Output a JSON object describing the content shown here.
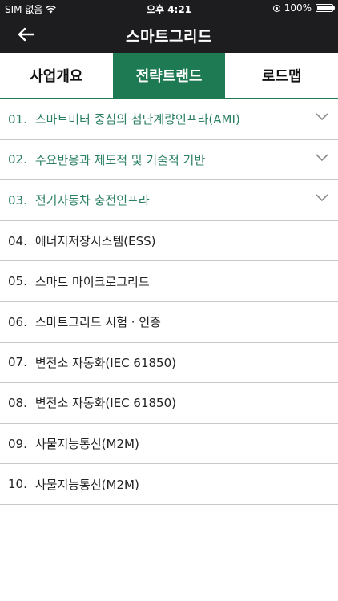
{
  "status_bar": {
    "carrier": "SIM 없음",
    "time": "오후 4:21",
    "battery": "100%",
    "battery_level": 1.0
  },
  "nav": {
    "title": "스마트그리드",
    "back_icon": "arrow-left-icon"
  },
  "tabs": [
    {
      "label": "사업개요",
      "active": false
    },
    {
      "label": "전략트랜드",
      "active": true
    },
    {
      "label": "로드맵",
      "active": false
    }
  ],
  "colors": {
    "brand": "#1e7a52",
    "expandable_text": "#2b8063",
    "bar": "#1d1d1f"
  },
  "list": [
    {
      "num": "01.",
      "label": "스마트미터 중심의 첨단계량인프라(AMI)",
      "expandable": true
    },
    {
      "num": "02.",
      "label": "수요반응과 제도적 및 기술적 기반",
      "expandable": true
    },
    {
      "num": "03.",
      "label": "전기자동차 충전인프라",
      "expandable": true
    },
    {
      "num": "04.",
      "label": "에너지저장시스템(ESS)",
      "expandable": false
    },
    {
      "num": "05.",
      "label": "스마트 마이크로그리드",
      "expandable": false
    },
    {
      "num": "06.",
      "label": "스마트그리드 시험 · 인증",
      "expandable": false
    },
    {
      "num": "07.",
      "label": "변전소 자동화(IEC 61850)",
      "expandable": false
    },
    {
      "num": "08.",
      "label": "변전소 자동화(IEC 61850)",
      "expandable": false
    },
    {
      "num": "09.",
      "label": "사물지능통신(M2M)",
      "expandable": false
    },
    {
      "num": "10.",
      "label": "사물지능통신(M2M)",
      "expandable": false
    }
  ]
}
